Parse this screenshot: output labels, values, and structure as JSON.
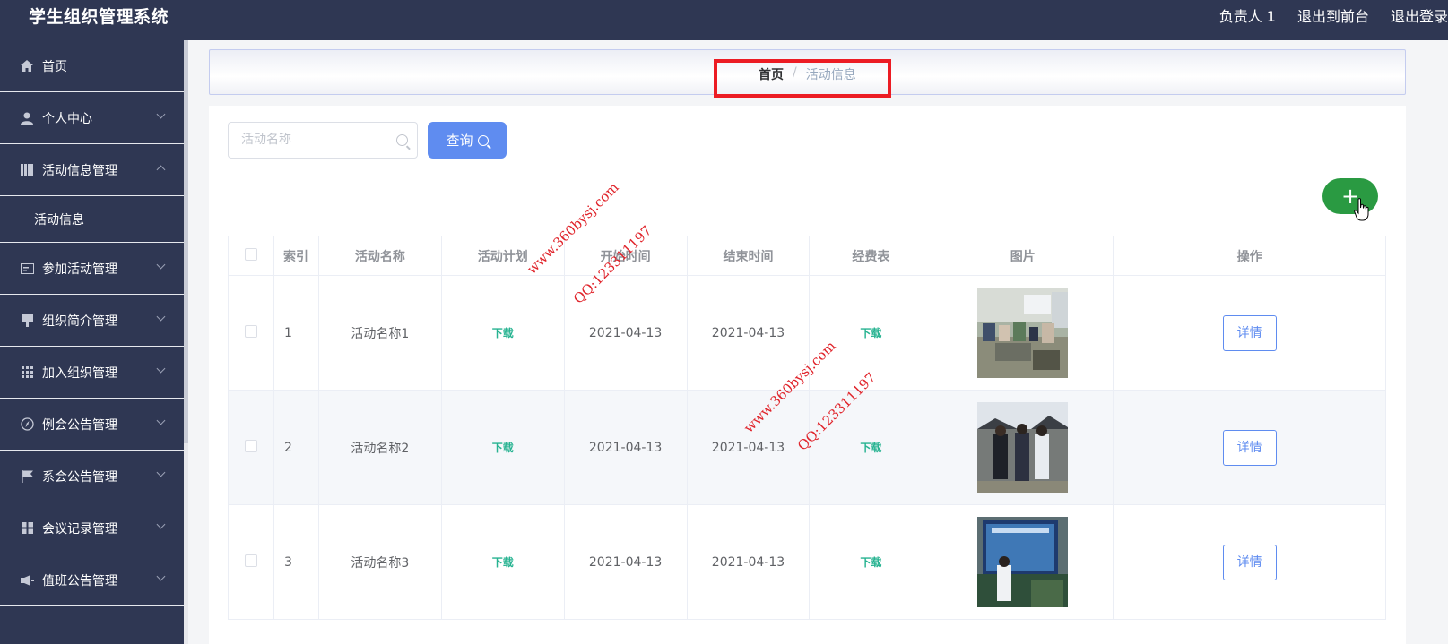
{
  "header": {
    "app_title": "学生组织管理系统",
    "user": "负责人 1",
    "exit_front": "退出到前台",
    "logout": "退出登录"
  },
  "sidebar": {
    "items": [
      {
        "label": "首页",
        "icon": "home-icon",
        "expandable": false
      },
      {
        "label": "个人中心",
        "icon": "user-icon",
        "expandable": true
      },
      {
        "label": "活动信息管理",
        "icon": "book-icon",
        "expandable": true,
        "expanded": true
      },
      {
        "label": "参加活动管理",
        "icon": "id-card-icon",
        "expandable": true
      },
      {
        "label": "组织简介管理",
        "icon": "stamp-icon",
        "expandable": true
      },
      {
        "label": "加入组织管理",
        "icon": "grid-icon",
        "expandable": true
      },
      {
        "label": "例会公告管理",
        "icon": "compass-icon",
        "expandable": true
      },
      {
        "label": "系会公告管理",
        "icon": "flag-icon",
        "expandable": true
      },
      {
        "label": "会议记录管理",
        "icon": "apps-icon",
        "expandable": true
      },
      {
        "label": "值班公告管理",
        "icon": "megaphone-icon",
        "expandable": true
      }
    ],
    "submenu": {
      "label": "活动信息"
    }
  },
  "breadcrumb": {
    "home": "首页",
    "separator": "/",
    "current": "活动信息"
  },
  "search": {
    "placeholder": "活动名称",
    "value": "",
    "button_label": "查询"
  },
  "add_button": {
    "label": "+"
  },
  "table": {
    "columns": [
      "索引",
      "活动名称",
      "活动计划",
      "开始时间",
      "结束时间",
      "经费表",
      "图片",
      "操作"
    ],
    "rows": [
      {
        "index": "1",
        "name": "活动名称1",
        "plan": "下载",
        "start": "2021-04-13",
        "end": "2021-04-13",
        "budget": "下载",
        "action": "详情"
      },
      {
        "index": "2",
        "name": "活动名称2",
        "plan": "下载",
        "start": "2021-04-13",
        "end": "2021-04-13",
        "budget": "下载",
        "action": "详情"
      },
      {
        "index": "3",
        "name": "活动名称3",
        "plan": "下载",
        "start": "2021-04-13",
        "end": "2021-04-13",
        "budget": "下载",
        "action": "详情"
      }
    ]
  },
  "watermarks": [
    {
      "line1": "www.360bysj.com",
      "line2": "QQ:123311197"
    },
    {
      "line1": "www.360bysj.com",
      "line2": "QQ:123311197"
    }
  ],
  "colors": {
    "sidebar_bg": "#2f3753",
    "primary": "#5f8cf0",
    "success": "#2a9a42",
    "link": "#27b391",
    "highlight": "#ec1c24"
  }
}
